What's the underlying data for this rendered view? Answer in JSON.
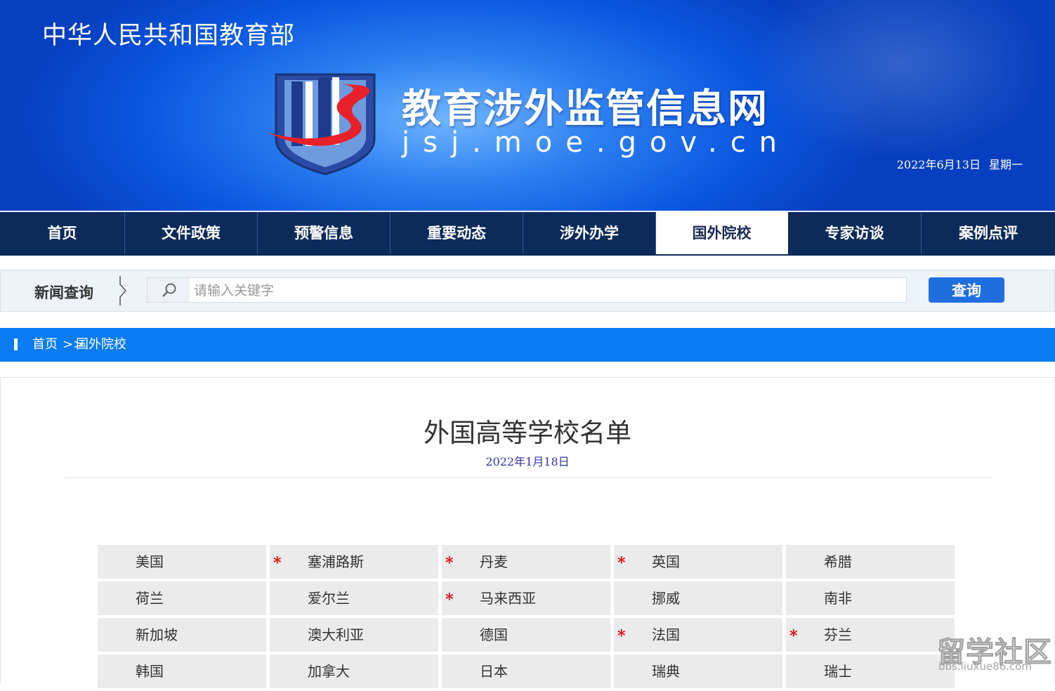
{
  "header": {
    "ministry": "中华人民共和国教育部",
    "site_title": "教育涉外监管信息网",
    "site_url": "jsj.moe.gov.cn",
    "date": "2022年6月13日",
    "weekday": "星期一",
    "colors": {
      "brand_blue": "#0b57e0",
      "logo_red": "#e8202a",
      "logo_navy": "#1f3d8a"
    }
  },
  "nav": {
    "items": [
      {
        "label": "首页"
      },
      {
        "label": "文件政策"
      },
      {
        "label": "预警信息"
      },
      {
        "label": "重要动态"
      },
      {
        "label": "涉外办学"
      },
      {
        "label": "国外院校",
        "active": true
      },
      {
        "label": "专家访谈"
      },
      {
        "label": "案例点评"
      }
    ]
  },
  "search": {
    "label": "新闻查询",
    "placeholder": "请输入关键字",
    "button": "查询",
    "icon": "search-icon"
  },
  "breadcrumb": {
    "home": "首页",
    "separator": ">>",
    "current": "国外院校"
  },
  "article": {
    "title": "外国高等学校名单",
    "date": "2022年1月18日"
  },
  "countries": {
    "star_symbol": "*",
    "rows": [
      [
        {
          "name": "美国",
          "star": false
        },
        {
          "name": "塞浦路斯",
          "star": true
        },
        {
          "name": "丹麦",
          "star": true
        },
        {
          "name": "英国",
          "star": true
        },
        {
          "name": "希腊",
          "star": false
        }
      ],
      [
        {
          "name": "荷兰",
          "star": false
        },
        {
          "name": "爱尔兰",
          "star": false
        },
        {
          "name": "马来西亚",
          "star": true
        },
        {
          "name": "挪威",
          "star": false
        },
        {
          "name": "南非",
          "star": false
        }
      ],
      [
        {
          "name": "新加坡",
          "star": false
        },
        {
          "name": "澳大利亚",
          "star": false
        },
        {
          "name": "德国",
          "star": false
        },
        {
          "name": "法国",
          "star": true
        },
        {
          "name": "芬兰",
          "star": true
        }
      ],
      [
        {
          "name": "韩国",
          "star": false
        },
        {
          "name": "加拿大",
          "star": false
        },
        {
          "name": "日本",
          "star": false
        },
        {
          "name": "瑞典",
          "star": false
        },
        {
          "name": "瑞士",
          "star": false
        }
      ]
    ]
  },
  "watermark": {
    "main": "留学社区",
    "url": "bbs.liuxue86.com"
  }
}
